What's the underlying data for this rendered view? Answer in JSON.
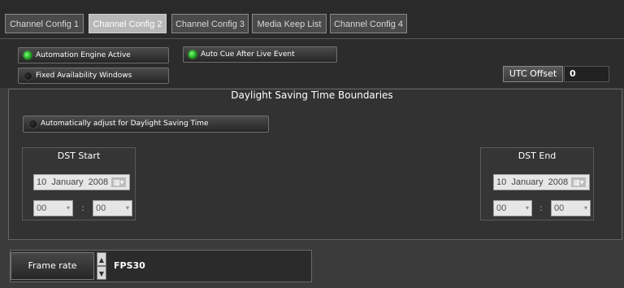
{
  "tabs": [
    {
      "label": "Channel Config 1",
      "active": false
    },
    {
      "label": "Channel Config 2",
      "active": true
    },
    {
      "label": "Channel Config 3",
      "active": false
    },
    {
      "label": "Media Keep List",
      "active": false
    },
    {
      "label": "Channel Config 4",
      "active": false
    }
  ],
  "toggles": {
    "automation_engine": {
      "label": "Automation Engine Active",
      "on": true
    },
    "auto_cue": {
      "label": "Auto Cue After Live Event",
      "on": true
    },
    "fixed_availability": {
      "label": "Fixed Availability Windows",
      "on": false
    },
    "auto_dst": {
      "label": "Automatically adjust for Daylight Saving Time",
      "on": false
    }
  },
  "utc": {
    "label": "UTC Offset",
    "value": "0"
  },
  "dst": {
    "title": "Daylight Saving Time Boundaries",
    "start": {
      "title": "DST Start",
      "day": "10",
      "month": "January",
      "year": "2008",
      "hour": "00",
      "minute": "00",
      "separator": ":"
    },
    "end": {
      "title": "DST End",
      "day": "10",
      "month": "January",
      "year": "2008",
      "hour": "00",
      "minute": "00",
      "separator": ":"
    }
  },
  "frame_rate": {
    "label": "Frame rate",
    "value": "FPS30"
  },
  "icons": {
    "calendar": "▦▾",
    "dropdown": "▾",
    "up": "▲",
    "down": "▼"
  }
}
